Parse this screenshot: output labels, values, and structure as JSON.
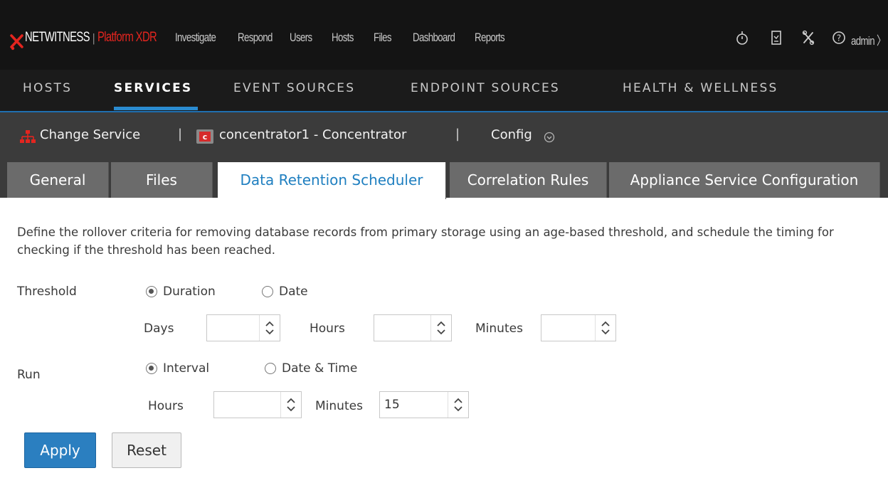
{
  "topbar": {
    "brand": "NETWITNESS",
    "platform": "Platform XDR",
    "nav": [
      "Investigate",
      "Respond",
      "Users",
      "Hosts",
      "Files",
      "Dashboard",
      "Reports"
    ],
    "icons": [
      "timer-icon",
      "clipboard-icon",
      "tools-icon",
      "help-icon"
    ],
    "user": "admin 〉"
  },
  "subnav": {
    "items": [
      "HOSTS",
      "SERVICES",
      "EVENT SOURCES",
      "ENDPOINT SOURCES",
      "HEALTH & WELLNESS"
    ],
    "active": "SERVICES"
  },
  "service_bar": {
    "change_service": "Change Service",
    "separator": "|",
    "service_name": "concentrator1 - Concentrator",
    "view": "Config"
  },
  "tabs": {
    "items": [
      "General",
      "Files",
      "Data Retention Scheduler",
      "Correlation Rules",
      "Appliance Service Configuration"
    ],
    "active": "Data Retention Scheduler"
  },
  "form": {
    "description": "Define the rollover criteria for removing database records from primary storage using an age-based threshold, and schedule the timing for checking if the threshold has been reached.",
    "threshold": {
      "label": "Threshold",
      "options": [
        "Duration",
        "Date"
      ],
      "selected": "Duration",
      "days_label": "Days",
      "days_value": "",
      "hours_label": "Hours",
      "hours_value": "",
      "minutes_label": "Minutes",
      "minutes_value": ""
    },
    "run": {
      "label": "Run",
      "options": [
        "Interval",
        "Date & Time"
      ],
      "selected": "Interval",
      "hours_label": "Hours",
      "hours_value": "",
      "minutes_label": "Minutes",
      "minutes_value": "15"
    },
    "apply_label": "Apply",
    "reset_label": "Reset"
  },
  "colors": {
    "accent": "#2b7fc0",
    "brand_red": "#e3251f",
    "topbar_bg": "#141414",
    "active_tab_text": "#1f7fc0"
  }
}
